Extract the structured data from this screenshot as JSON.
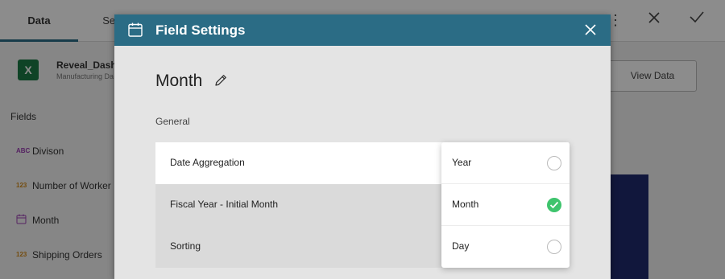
{
  "left_tabs": {
    "data": "Data",
    "settings": "Set"
  },
  "data_source": {
    "icon": "excel-icon",
    "icon_glyph": "X",
    "name": "Reveal_Dashb",
    "subtitle": "Manufacturing Da"
  },
  "fields": {
    "title": "Fields",
    "items": [
      {
        "type": "ABC",
        "name": "Divison"
      },
      {
        "type": "123",
        "name": "Number of Worker"
      },
      {
        "type": "calendar-icon",
        "name": "Month"
      },
      {
        "type": "123",
        "name": "Shipping Orders"
      }
    ]
  },
  "toolbar": {
    "view_data_label": "View Data"
  },
  "modal": {
    "title": "Field Settings",
    "field_name": "Month",
    "section_label": "General",
    "rows": [
      {
        "label": "Date Aggregation"
      },
      {
        "label": "Fiscal Year - Initial Month"
      },
      {
        "label": "Sorting"
      }
    ],
    "dropdown": {
      "options": [
        {
          "label": "Year",
          "selected": false
        },
        {
          "label": "Month",
          "selected": true
        },
        {
          "label": "Day",
          "selected": false
        }
      ]
    }
  },
  "colors": {
    "header": "#2b6c85",
    "accent_check": "#3ec46d",
    "chart": "#1f2a6e"
  }
}
